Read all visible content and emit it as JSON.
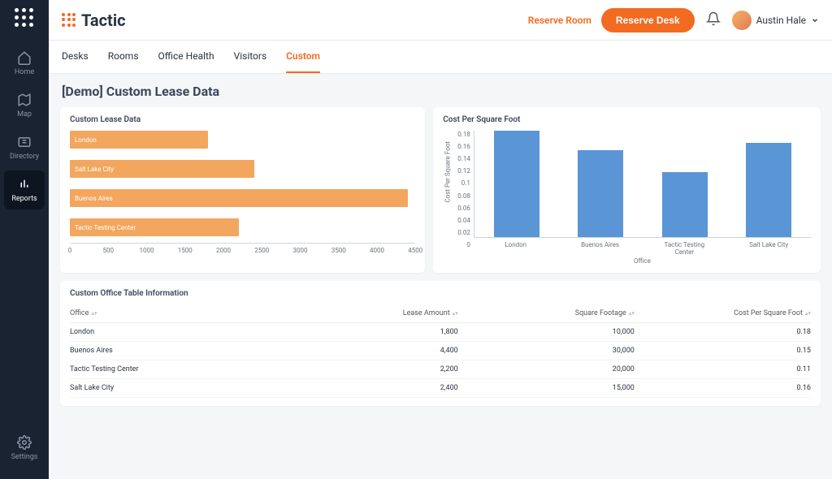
{
  "brand": "Tactic",
  "topbar": {
    "reserve_room": "Reserve Room",
    "reserve_desk": "Reserve Desk",
    "user_name": "Austin Hale"
  },
  "sidebar": {
    "items": [
      {
        "label": "Home"
      },
      {
        "label": "Map"
      },
      {
        "label": "Directory"
      },
      {
        "label": "Reports"
      }
    ],
    "settings_label": "Settings"
  },
  "tabs": [
    {
      "label": "Desks"
    },
    {
      "label": "Rooms"
    },
    {
      "label": "Office Health"
    },
    {
      "label": "Visitors"
    },
    {
      "label": "Custom"
    }
  ],
  "page_title": "[Demo] Custom Lease Data",
  "card_left_title": "Custom Lease Data",
  "card_right_title": "Cost Per Square Foot",
  "chart_data": [
    {
      "type": "bar",
      "orientation": "horizontal",
      "title": "Custom Lease Data",
      "categories": [
        "London",
        "Salt Lake City",
        "Buenos Aires",
        "Tactic Testing Center"
      ],
      "values": [
        1800,
        2400,
        4400,
        2200
      ],
      "xlim": [
        0,
        4500
      ],
      "xticks": [
        0,
        500,
        1000,
        1500,
        2000,
        2500,
        3000,
        3500,
        4000,
        4500
      ]
    },
    {
      "type": "bar",
      "orientation": "vertical",
      "title": "Cost Per Square Foot",
      "xlabel": "Office",
      "ylabel": "Cost Per Square Foot",
      "categories": [
        "London",
        "Buenos Aires",
        "Tactic Testing Center",
        "Salt Lake City"
      ],
      "values": [
        0.18,
        0.147,
        0.11,
        0.16
      ],
      "ylim": [
        0,
        0.18
      ],
      "yticks": [
        0,
        0.02,
        0.04,
        0.06,
        0.08,
        0.1,
        0.12,
        0.14,
        0.16,
        0.18
      ]
    }
  ],
  "table": {
    "title": "Custom Office Table Information",
    "columns": [
      "Office",
      "Lease Amount",
      "Square Footage",
      "Cost Per Square Foot"
    ],
    "rows": [
      {
        "office": "London",
        "lease": "1,800",
        "sqft": "10,000",
        "cpsf": "0.18"
      },
      {
        "office": "Buenos Aires",
        "lease": "4,400",
        "sqft": "30,000",
        "cpsf": "0.15"
      },
      {
        "office": "Tactic Testing Center",
        "lease": "2,200",
        "sqft": "20,000",
        "cpsf": "0.11"
      },
      {
        "office": "Salt Lake City",
        "lease": "2,400",
        "sqft": "15,000",
        "cpsf": "0.16"
      }
    ]
  }
}
